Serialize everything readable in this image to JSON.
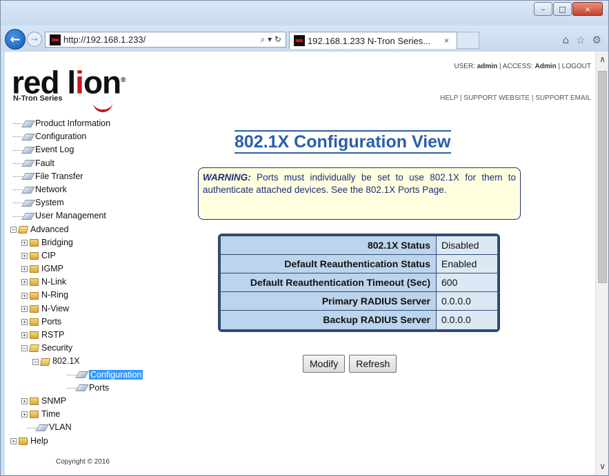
{
  "browser": {
    "back_icon": "arrow-left-icon",
    "forward_icon": "arrow-right-icon",
    "address": "http://192.168.1.233/",
    "address_tools": "⌕ ▾ ↻",
    "tab_title": "192.168.1.233 N-Tron Series...",
    "tab_close": "×",
    "tool_icons": [
      "home-icon",
      "star-icon",
      "gear-icon"
    ],
    "window_controls": [
      "–",
      "□",
      "×"
    ]
  },
  "header": {
    "logo_word_before": "red l",
    "logo_word_i": "i",
    "logo_word_after": "on",
    "logo_reg": "®",
    "logo_sub": "N-Tron Series",
    "user_label": "USER:",
    "user": "admin",
    "access_label": "ACCESS:",
    "access": "Admin",
    "logout": "LOGOUT",
    "help": "HELP",
    "support_site": "SUPPORT WEBSITE",
    "support_email": "SUPPORT EMAIL"
  },
  "tree": {
    "items": [
      {
        "label": "Product Information"
      },
      {
        "label": "Configuration"
      },
      {
        "label": "Event Log"
      },
      {
        "label": "Fault"
      },
      {
        "label": "File Transfer"
      },
      {
        "label": "Network"
      },
      {
        "label": "System"
      },
      {
        "label": "User Management"
      },
      {
        "label": "Advanced"
      },
      {
        "label": "Bridging"
      },
      {
        "label": "CIP"
      },
      {
        "label": "IGMP"
      },
      {
        "label": "N-Link"
      },
      {
        "label": "N-Ring"
      },
      {
        "label": "N-View"
      },
      {
        "label": "Ports"
      },
      {
        "label": "RSTP"
      },
      {
        "label": "Security"
      },
      {
        "label": "802.1X"
      },
      {
        "label": "Configuration"
      },
      {
        "label": "Ports"
      },
      {
        "label": "SNMP"
      },
      {
        "label": "Time"
      },
      {
        "label": "VLAN"
      },
      {
        "label": "Help"
      }
    ],
    "expand_minus": "−",
    "expand_plus": "+"
  },
  "copyright": "Copyright © 2016",
  "main": {
    "title": "802.1X Configuration View",
    "warning_label": "WARNING:",
    "warning_text": " Ports must individually be set to use 802.1X for them to authenticate attached devices. See the 802.1X Ports Page.",
    "rows": [
      {
        "label": "802.1X Status",
        "value": "Disabled"
      },
      {
        "label": "Default Reauthentication Status",
        "value": "Enabled"
      },
      {
        "label": "Default Reauthentication Timeout (Sec)",
        "value": "600"
      },
      {
        "label": "Primary RADIUS Server",
        "value": "0.0.0.0"
      },
      {
        "label": "Backup RADIUS Server",
        "value": "0.0.0.0"
      }
    ],
    "modify_label": "Modify",
    "refresh_label": "Refresh"
  },
  "scrollbar": {
    "up": "∧",
    "down": "∨"
  }
}
